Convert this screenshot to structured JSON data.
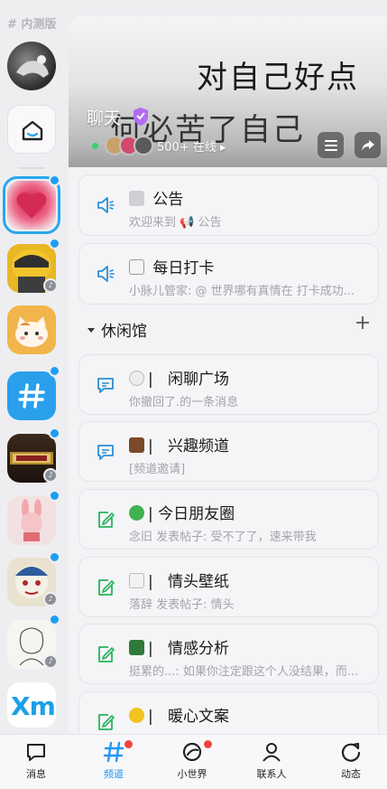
{
  "rail": {
    "beta_label": "# 内测版",
    "xm_label": "Xm"
  },
  "banner": {
    "headline_1": "对自己好点",
    "headline_2": "何必苦了自己",
    "title": "聊天",
    "online_text": "500+ 在线 ▸"
  },
  "cards": [
    {
      "name": "公告",
      "sub": "欢迎来到 📢 公告",
      "icon": "megaphone-icon"
    },
    {
      "name": "每日打卡",
      "sub": "小脉儿管家: @ 世界哪有真情在   打卡成功...",
      "icon": "megaphone-icon"
    }
  ],
  "section": {
    "title": "休闲馆"
  },
  "channels": [
    {
      "name": "闲聊广场",
      "sub": "你撤回了.的一条消息",
      "icon": "chat-icon",
      "color": "#2b8fd6"
    },
    {
      "name": "兴趣频道",
      "sub": "[频道邀请]",
      "icon": "chat-icon",
      "color": "#2b8fd6"
    },
    {
      "name": "今日朋友圈",
      "sub": "念旧 发表帖子: 受不了了，速来带我",
      "icon": "post-icon",
      "color": "#27b35b"
    },
    {
      "name": "情头壁纸",
      "sub": "落辞 发表帖子: 情头",
      "icon": "post-icon",
      "color": "#27b35b"
    },
    {
      "name": "情感分析",
      "sub": "挺累的...: 如果你注定跟这个人没结果，而...",
      "icon": "post-icon",
      "color": "#27b35b"
    },
    {
      "name": "暖心文案",
      "sub": "",
      "icon": "post-icon",
      "color": "#27b35b"
    }
  ],
  "bottom_nav": [
    {
      "label": "消息"
    },
    {
      "label": "频道"
    },
    {
      "label": "小世界"
    },
    {
      "label": "联系人"
    },
    {
      "label": "动态"
    }
  ],
  "colors": {
    "accent": "#2096f3",
    "badge": "#1e9ef3",
    "notify": "#f0443d"
  }
}
